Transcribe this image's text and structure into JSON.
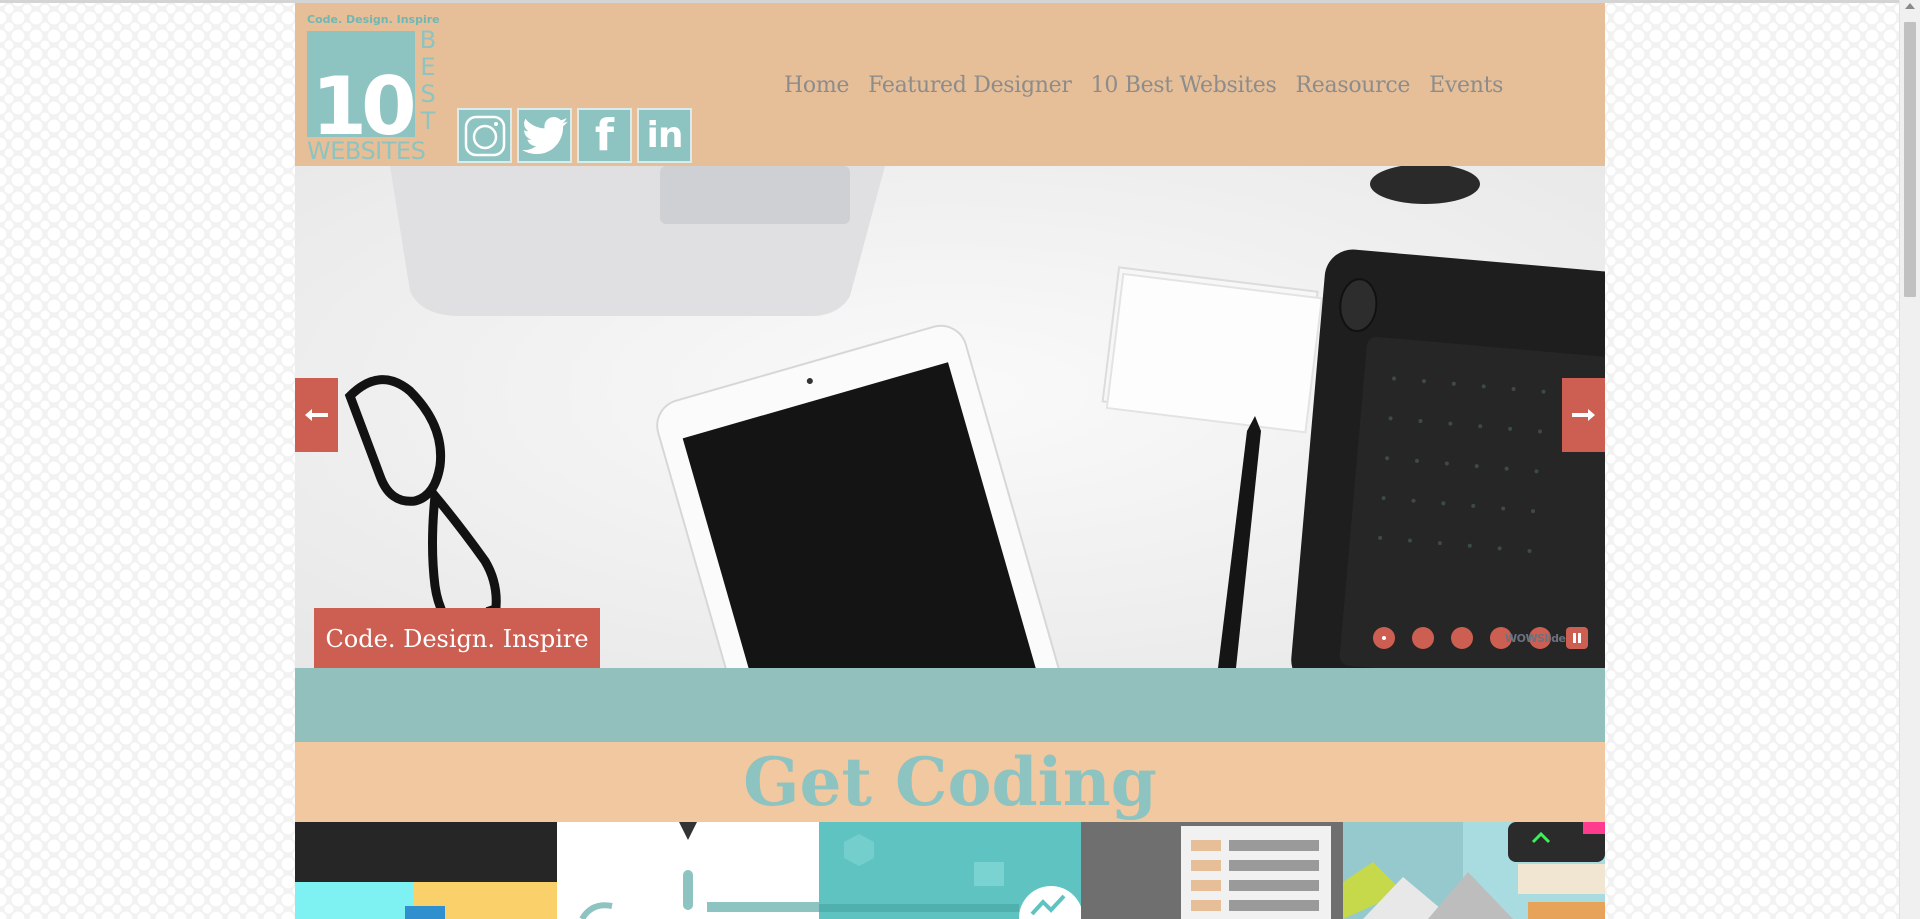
{
  "logo": {
    "tagline": "Code. Design. Inspire",
    "number": "10",
    "best": "BEST",
    "websites": "WEBSITES"
  },
  "social": [
    {
      "name": "instagram-icon",
      "label": "Instagram"
    },
    {
      "name": "twitter-icon",
      "label": "Twitter"
    },
    {
      "name": "facebook-icon",
      "label": "f"
    },
    {
      "name": "linkedin-icon",
      "label": "in"
    }
  ],
  "nav": {
    "items": [
      {
        "label": "Home"
      },
      {
        "label": "Featured Designer"
      },
      {
        "label": "10 Best Websites"
      },
      {
        "label": "Reasource"
      },
      {
        "label": "Events"
      }
    ]
  },
  "hero": {
    "caption": "Code. Design. Inspire",
    "slide_count": 5,
    "active_slide": 1,
    "badge": "WOWSlider",
    "prev_icon": "arrow-left-icon",
    "next_icon": "arrow-right-icon",
    "pause_icon": "pause-icon"
  },
  "section": {
    "title": "Get Coding"
  },
  "colors": {
    "header_bg": "#e6bf98",
    "accent_red": "#cd5f52",
    "teal": "#8dc3c0",
    "peach": "#f2c8a0",
    "nav_text": "#8c8c8c"
  }
}
